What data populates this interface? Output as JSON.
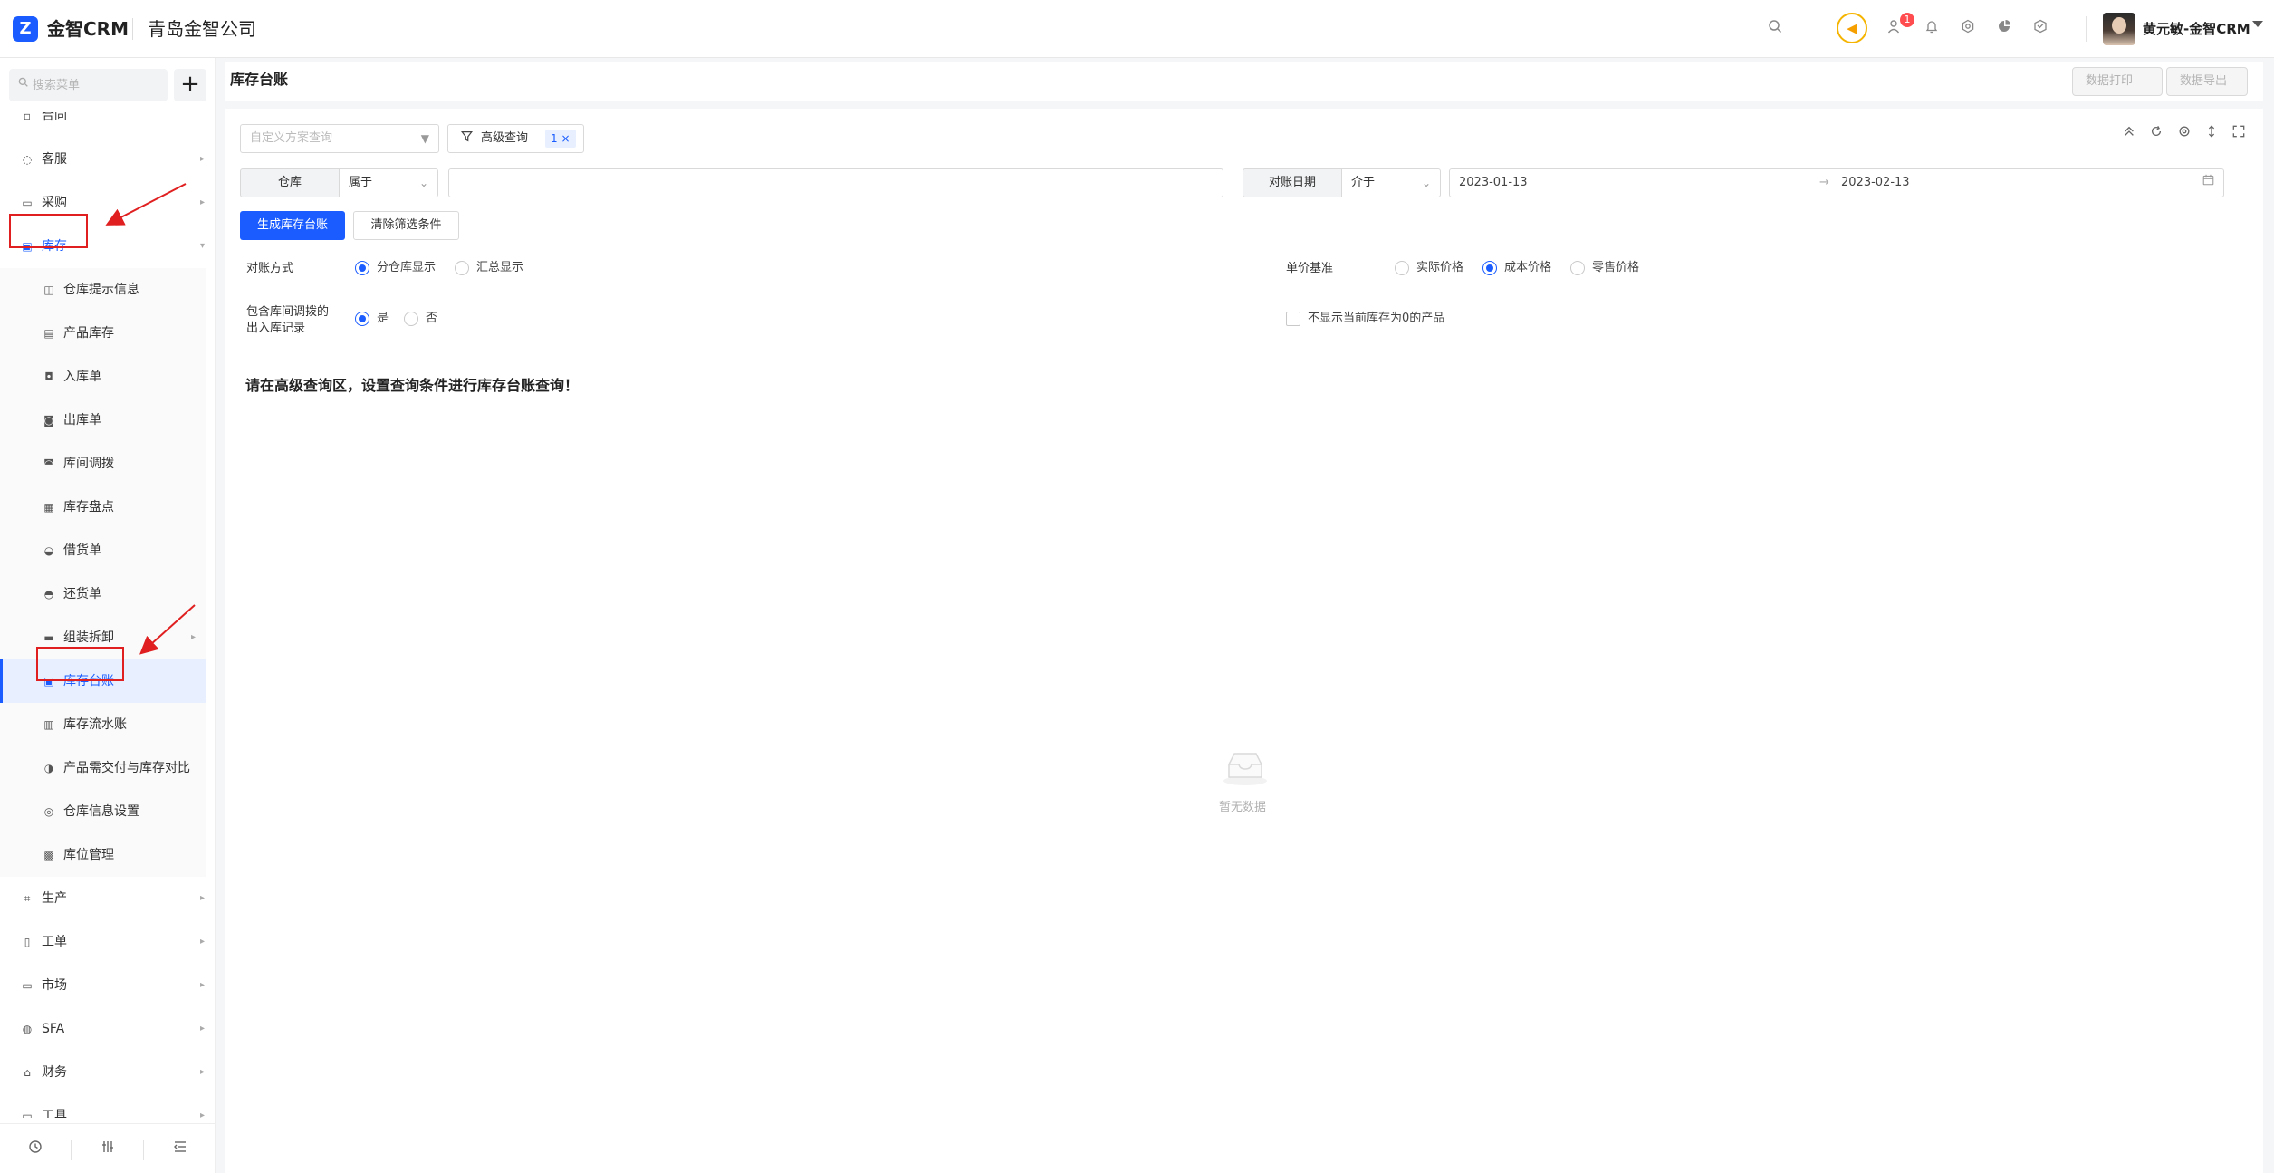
{
  "topbar": {
    "logo_text": "金智CRM",
    "company": "青岛金智公司",
    "user_name": "黄元敏-金智CRM",
    "notification_count": "1"
  },
  "sidebar": {
    "search_placeholder": "搜索菜单",
    "partial_item": "合同",
    "items": [
      {
        "label": "客服",
        "icon": "headset-icon"
      },
      {
        "label": "采购",
        "icon": "cart-icon"
      },
      {
        "label": "库存",
        "icon": "warehouse-icon"
      },
      {
        "label": "生产",
        "icon": "factory-icon"
      },
      {
        "label": "工单",
        "icon": "document-icon"
      },
      {
        "label": "市场",
        "icon": "market-icon"
      },
      {
        "label": "SFA",
        "icon": "sfa-icon"
      },
      {
        "label": "财务",
        "icon": "finance-icon"
      },
      {
        "label": "工具",
        "icon": "toolbox-icon"
      }
    ],
    "sub_items": [
      {
        "label": "仓库提示信息",
        "icon": "info-icon"
      },
      {
        "label": "产品库存",
        "icon": "box-icon"
      },
      {
        "label": "入库单",
        "icon": "inbound-icon"
      },
      {
        "label": "出库单",
        "icon": "outbound-icon"
      },
      {
        "label": "库间调拨",
        "icon": "transfer-icon"
      },
      {
        "label": "库存盘点",
        "icon": "checklist-icon"
      },
      {
        "label": "借货单",
        "icon": "borrow-icon"
      },
      {
        "label": "还货单",
        "icon": "return-icon"
      },
      {
        "label": "组装拆卸",
        "icon": "folder-icon"
      },
      {
        "label": "库存台账",
        "icon": "ledger-icon"
      },
      {
        "label": "库存流水账",
        "icon": "flow-icon"
      },
      {
        "label": "产品需交付与库存对比",
        "icon": "compare-icon"
      },
      {
        "label": "仓库信息设置",
        "icon": "settings-icon"
      },
      {
        "label": "库位管理",
        "icon": "location-grid-icon"
      }
    ]
  },
  "header": {
    "title": "库存台账",
    "print_label": "数据打印",
    "export_label": "数据导出"
  },
  "filters": {
    "scheme_placeholder": "自定义方案查询",
    "advanced_label": "高级查询",
    "advanced_count": "1 ×",
    "warehouse_label": "仓库",
    "warehouse_operator": "属于",
    "date_label": "对账日期",
    "date_operator": "介于",
    "date_start": "2023-01-13",
    "date_end": "2023-02-13",
    "generate_label": "生成库存台账",
    "clear_label": "清除筛选条件"
  },
  "options": {
    "method_label": "对账方式",
    "method_options": [
      "分仓库显示",
      "汇总显示"
    ],
    "price_label": "单价基准",
    "price_options": [
      "实际价格",
      "成本价格",
      "零售价格"
    ],
    "include_label_line1": "包含库间调拨的",
    "include_label_line2": "出入库记录",
    "include_options": [
      "是",
      "否"
    ],
    "hide_zero_label": "不显示当前库存为0的产品"
  },
  "hint": "请在高级查询区，设置查询条件进行库存台账查询！",
  "empty_text": "暂无数据",
  "colors": {
    "primary": "#1a5cff",
    "annotation_red": "#e02020",
    "badge": "#ff4d4f",
    "notice": "#f5a000"
  }
}
